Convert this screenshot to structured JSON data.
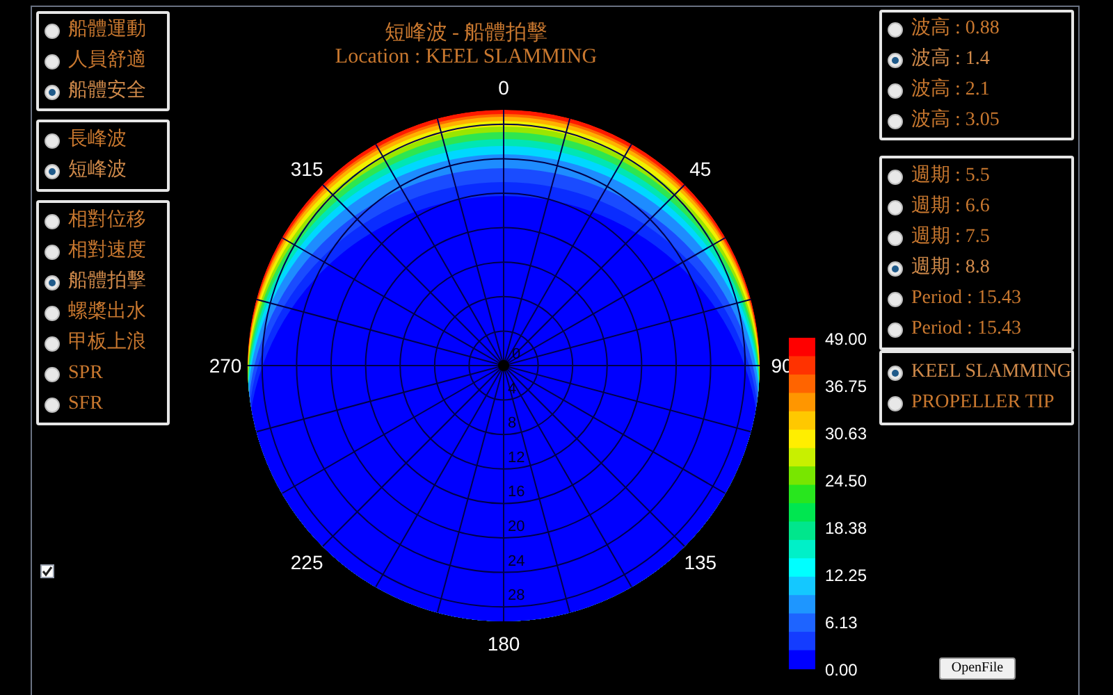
{
  "title": {
    "line_1": "短峰波 - 船體拍擊",
    "line_2": "Location : KEEL SLAMMING"
  },
  "left_panels": [
    {
      "options": [
        {
          "label": "船體運動",
          "selected": false
        },
        {
          "label": "人員舒適",
          "selected": false
        },
        {
          "label": "船體安全",
          "selected": true
        }
      ]
    },
    {
      "options": [
        {
          "label": "長峰波",
          "selected": false
        },
        {
          "label": "短峰波",
          "selected": true
        }
      ]
    },
    {
      "options": [
        {
          "label": "相對位移",
          "selected": false
        },
        {
          "label": "相對速度",
          "selected": false
        },
        {
          "label": "船體拍擊",
          "selected": true
        },
        {
          "label": "螺槳出水",
          "selected": false
        },
        {
          "label": "甲板上浪",
          "selected": false
        },
        {
          "label": "SPR",
          "selected": false
        },
        {
          "label": "SFR",
          "selected": false
        }
      ]
    }
  ],
  "right_panels": [
    {
      "options": [
        {
          "label": "波高 : 0.88",
          "selected": false
        },
        {
          "label": "波高 : 1.4",
          "selected": true
        },
        {
          "label": "波高 : 2.1",
          "selected": false
        },
        {
          "label": "波高 : 3.05",
          "selected": false
        }
      ]
    },
    {
      "options": [
        {
          "label": "週期 : 5.5",
          "selected": false
        },
        {
          "label": "週期 : 6.6",
          "selected": false
        },
        {
          "label": "週期 : 7.5",
          "selected": false
        },
        {
          "label": "週期 : 8.8",
          "selected": true
        },
        {
          "label": "Period : 15.43",
          "selected": false
        },
        {
          "label": "Period : 15.43",
          "selected": false
        }
      ]
    },
    {
      "options": [
        {
          "label": "KEEL SLAMMING",
          "selected": true
        },
        {
          "label": "PROPELLER TIP",
          "selected": false
        }
      ]
    }
  ],
  "polar_plot": {
    "angle_labels": [
      "0",
      "45",
      "90",
      "135",
      "180",
      "225",
      "270",
      "315"
    ],
    "radius_labels": [
      "0",
      "4",
      "8",
      "12",
      "16",
      "20",
      "24",
      "28"
    ]
  },
  "colorbar": {
    "labels": [
      "49.00",
      "36.75",
      "30.63",
      "24.50",
      "18.38",
      "12.25",
      "6.13",
      "0.00"
    ]
  },
  "checkbox": {
    "checked": true
  },
  "open_file_button": {
    "label": "OpenFile"
  }
}
